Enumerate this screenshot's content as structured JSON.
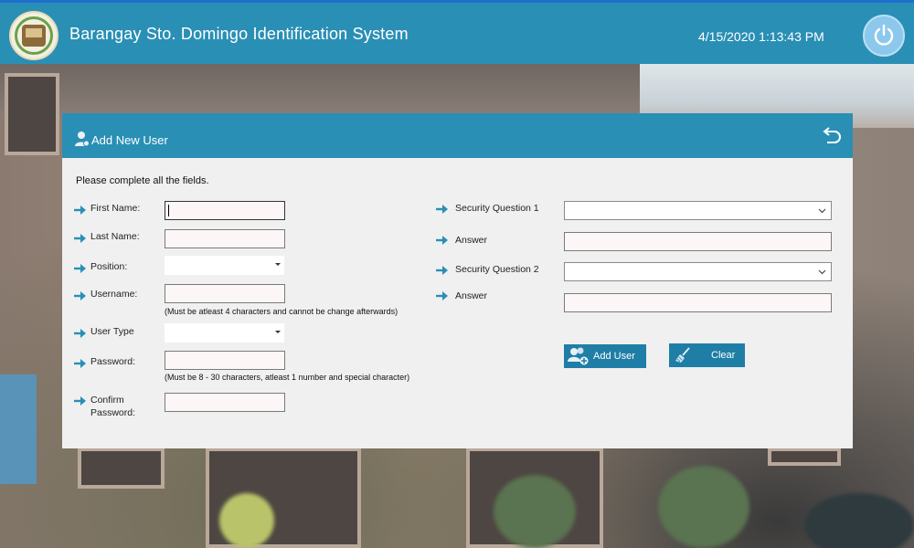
{
  "app": {
    "title": "Barangay Sto. Domingo Identification System",
    "datetime": "4/15/2020 1:13:43 PM",
    "logo_icon": "barangay-seal-logo",
    "power_icon": "power-icon"
  },
  "colors": {
    "header": "#2a8fb5",
    "panel_bg": "#f0f0f0",
    "button": "#1f7ea6",
    "arrow": "#2a8fb5"
  },
  "panel": {
    "title": "Add New User",
    "title_icon": "user-add-icon",
    "back_icon": "back-arrow-icon",
    "instruction": "Please complete all the fields."
  },
  "form": {
    "first_name": {
      "label": "First Name:",
      "value": ""
    },
    "last_name": {
      "label": "Last Name:",
      "value": ""
    },
    "position": {
      "label": "Position:",
      "value": ""
    },
    "username": {
      "label": "Username:",
      "value": "",
      "hint": "(Must be atleast 4 characters and cannot be change afterwards)"
    },
    "user_type": {
      "label": "User Type",
      "value": ""
    },
    "password": {
      "label": "Password:",
      "value": "",
      "hint": "(Must be 8 - 30 characters, atleast 1 number and special character)"
    },
    "confirm_password": {
      "label_line1": "Confirm",
      "label_line2": "Password:",
      "value": ""
    },
    "security_question_1": {
      "label": "Security Question 1",
      "value": ""
    },
    "answer_1": {
      "label": "Answer",
      "value": ""
    },
    "security_question_2": {
      "label": "Security Question 2",
      "value": ""
    },
    "answer_2": {
      "label": "Answer",
      "value": ""
    }
  },
  "buttons": {
    "add_user": {
      "label": "Add User",
      "icon": "add-users-icon"
    },
    "clear": {
      "label": "Clear",
      "icon": "broom-icon"
    }
  }
}
